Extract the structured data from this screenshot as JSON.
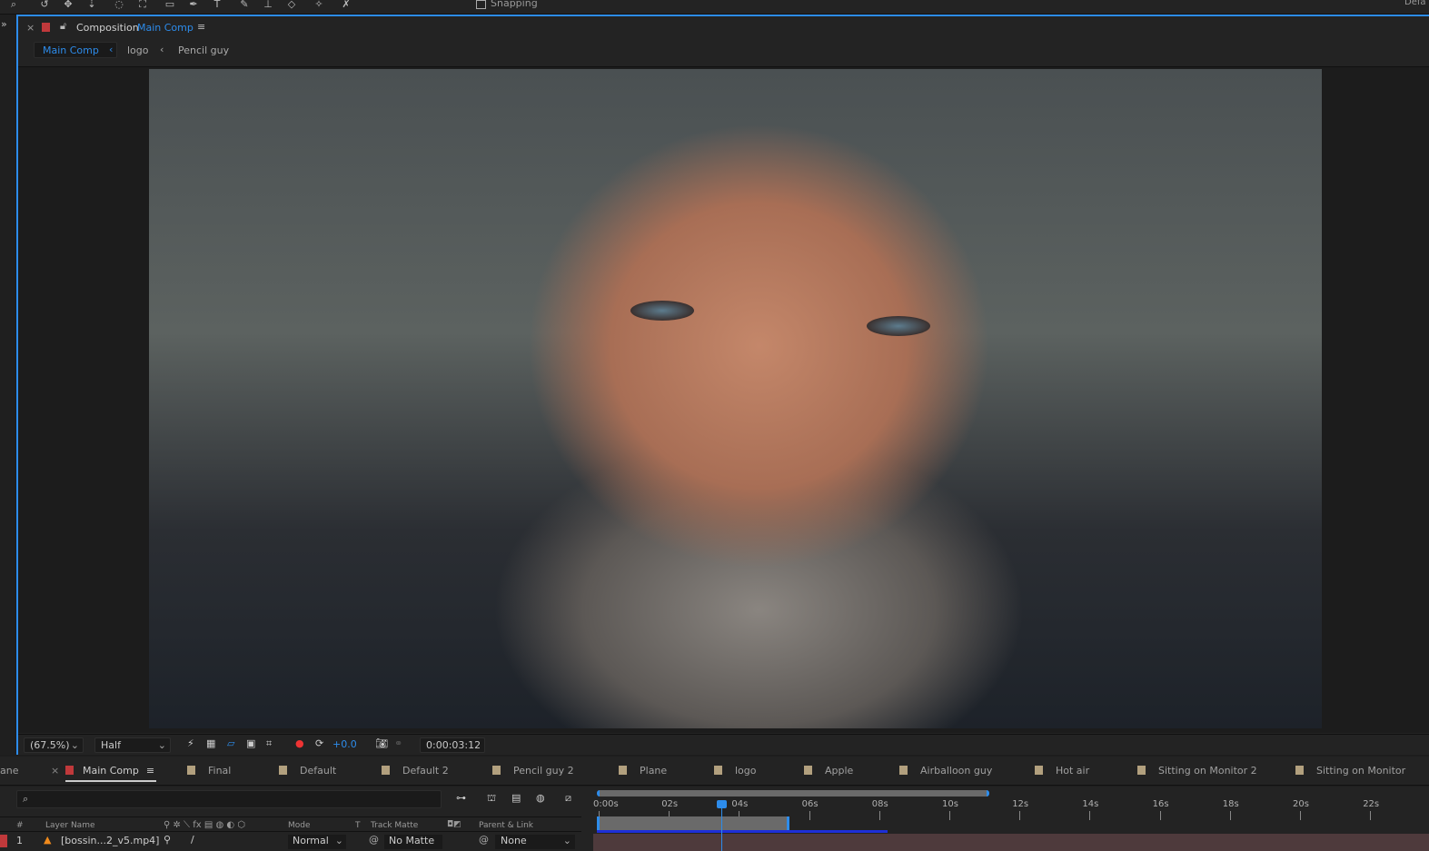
{
  "toolbar": {
    "snapping_label": "Snapping",
    "workspace": "Defa"
  },
  "comp_panel": {
    "title_prefix": "Composition",
    "title_name": "Main Comp",
    "breadcrumb": [
      "Main Comp",
      "logo",
      "Pencil guy"
    ]
  },
  "viewer_bar": {
    "zoom": "(67.5%)",
    "resolution": "Half",
    "exposure": "+0.0",
    "timecode": "0:00:03:12"
  },
  "timeline_tabs": {
    "left_cut": "ane",
    "active": "Main Comp",
    "others": [
      "Final",
      "Default",
      "Default 2",
      "Pencil guy 2",
      "Plane",
      "logo",
      "Apple",
      "Airballoon guy",
      "Hot air",
      "Sitting on Monitor 2",
      "Sitting on Monitor"
    ]
  },
  "timeline": {
    "columns": {
      "num": "#",
      "layer_name": "Layer Name",
      "mode": "Mode",
      "t": "T",
      "track_matte": "Track Matte",
      "parent": "Parent & Link"
    },
    "ruler": [
      "0:00s",
      "02s",
      "04s",
      "06s",
      "08s",
      "10s",
      "12s",
      "14s",
      "16s",
      "18s",
      "20s",
      "22s"
    ],
    "current_time_seconds": 3.5,
    "layers": [
      {
        "num": "1",
        "name": "[bossin...2_v5.mp4]",
        "mode": "Normal",
        "track_matte": "No Matte",
        "parent": "None"
      }
    ]
  },
  "colors": {
    "accent": "#2d8ceb",
    "comp_label": "#c0393b",
    "tab_swatch": "#b2a07e"
  }
}
